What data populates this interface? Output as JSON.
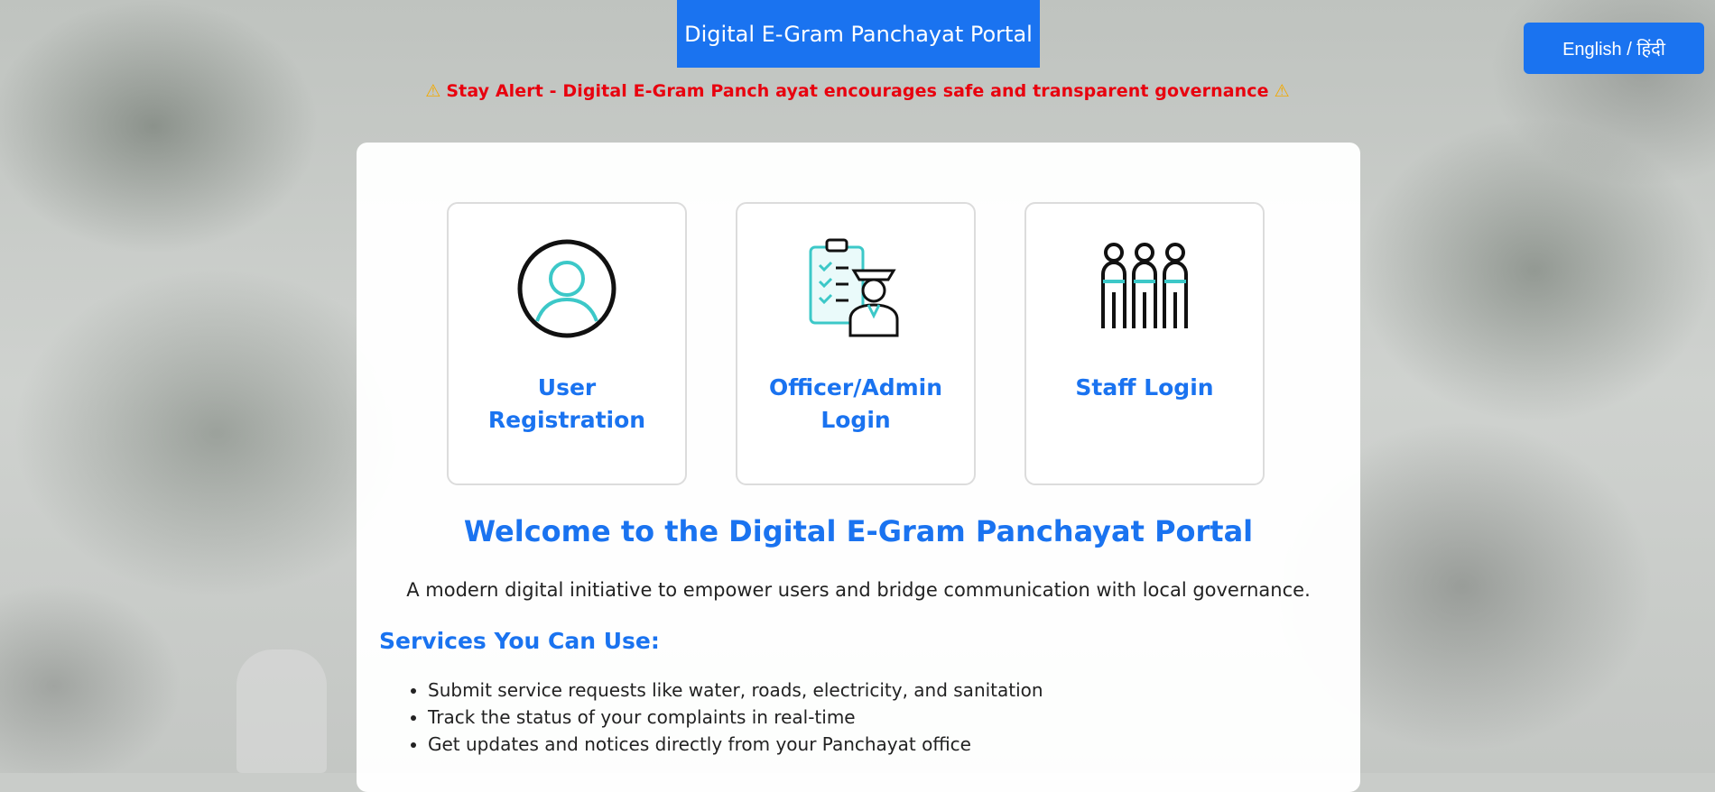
{
  "header": {
    "title": "Digital E-Gram Panchayat Portal",
    "language_button": "English / हिंदी"
  },
  "alert": {
    "icon": "warning-icon",
    "text": "Stay Alert - Digital E-Gram Panch ayat encourages safe and transparent governance",
    "color": "#e8000e"
  },
  "options": [
    {
      "label": "User Registration",
      "icon": "user-profile-icon"
    },
    {
      "label": "Officer/Admin Login",
      "icon": "officer-clipboard-icon"
    },
    {
      "label": "Staff Login",
      "icon": "staff-group-icon"
    }
  ],
  "main": {
    "welcome": "Welcome to the Digital E-Gram Panchayat Portal",
    "tagline": "A modern digital initiative to empower users and bridge communication with local governance.",
    "services_title": "Services You Can Use:",
    "services": [
      "Submit service requests like water, roads, electricity, and sanitation",
      "Track the status of your complaints in real-time",
      "Get updates and notices directly from your Panchayat office"
    ]
  },
  "colors": {
    "accent": "#1a73f0",
    "icon_teal": "#3cc8c8"
  }
}
